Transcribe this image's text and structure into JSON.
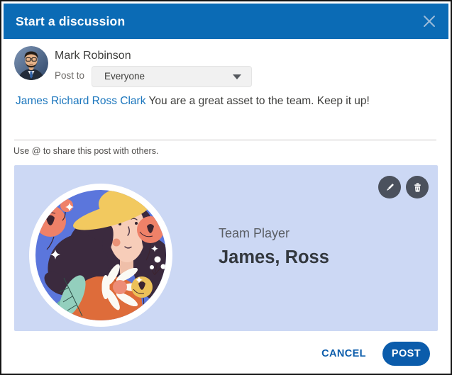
{
  "window": {
    "title": "Start a discussion"
  },
  "author": {
    "name": "Mark Robinson",
    "post_to_label": "Post to",
    "audience_selected": "Everyone"
  },
  "composer": {
    "mention": "James Richard Ross Clark",
    "message": "You are a great asset to the team. Keep it up!",
    "helper_text": "Use @ to share this post with others."
  },
  "attachment_card": {
    "badge_title": "Team Player",
    "recipient_name": "James, Ross"
  },
  "footer": {
    "cancel_label": "CANCEL",
    "post_label": "POST"
  },
  "icons": {
    "close": "close-icon",
    "dropdown": "chevron-down-icon",
    "edit": "pencil-icon",
    "delete": "trash-icon",
    "illustration": "team-player-badge-illustration",
    "avatar": "mark-robinson-photo"
  },
  "colors": {
    "header_blue": "#0b6bb5",
    "action_blue": "#0b5cab",
    "mention_blue": "#1b76bd",
    "card_background": "#ccd8f4",
    "badge_circle_blue": "#5b76dc",
    "icon_button_gray": "#4b515d"
  }
}
